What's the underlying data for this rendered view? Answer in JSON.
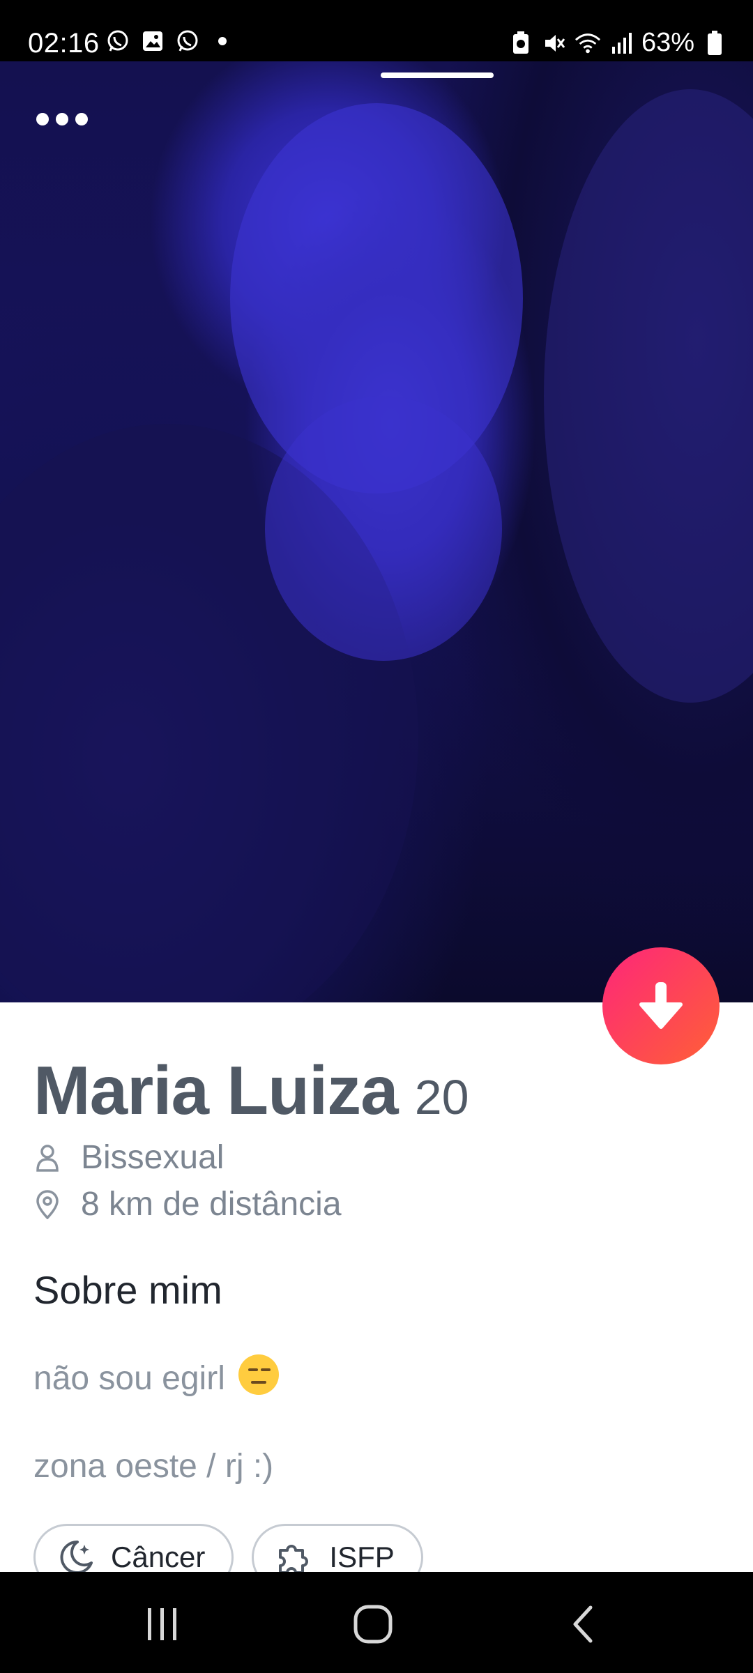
{
  "status_bar": {
    "time": "02:16",
    "battery": "63%",
    "left_icons": [
      "whatsapp-icon",
      "gallery-icon",
      "whatsapp-icon",
      "dot-icon"
    ],
    "right_icons": [
      "battery-saver-icon",
      "mute-icon",
      "wifi-icon",
      "signal-icon",
      "battery-icon"
    ]
  },
  "profile": {
    "name": "Maria Luiza",
    "age": "20",
    "orientation": "Bissexual",
    "distance": "8 km de distância"
  },
  "about": {
    "title": "Sobre mim",
    "lines": [
      "não sou egirl",
      "zona oeste / rj :)"
    ]
  },
  "chips": [
    {
      "icon": "moon-icon",
      "label": "Câncer"
    },
    {
      "icon": "puzzle-icon",
      "label": "ISFP"
    }
  ],
  "colors": {
    "accent_start": "#fd267a",
    "accent_end": "#ff6036",
    "photo_tint": "#2c25a6"
  }
}
